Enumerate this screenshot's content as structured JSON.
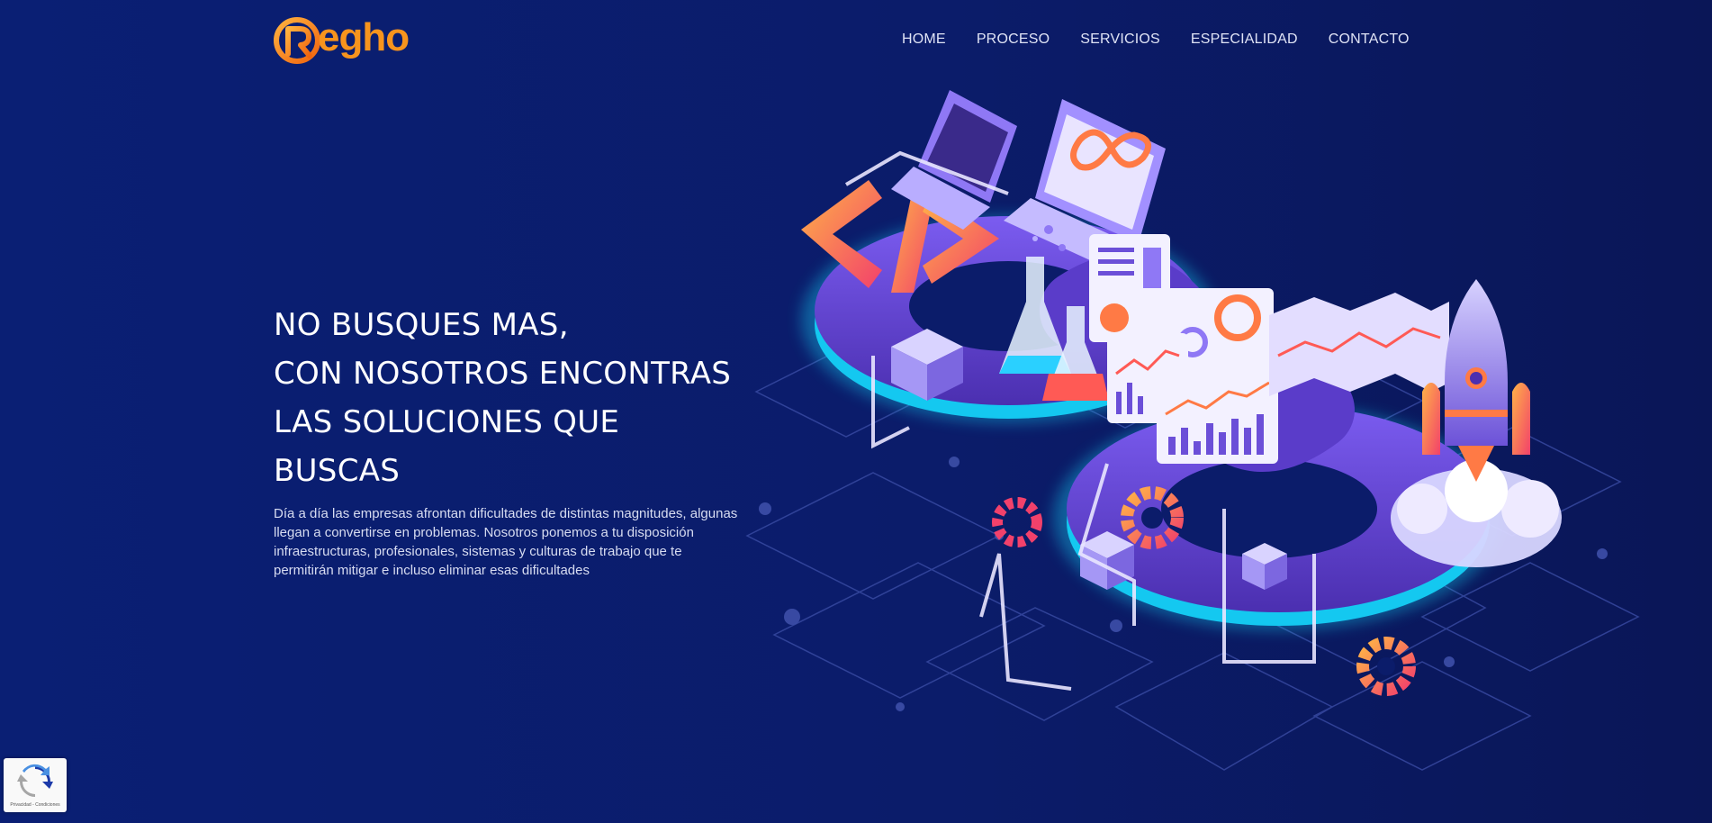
{
  "brand": {
    "logo_text": "egho",
    "logo_icon": "r-circle-logo-icon"
  },
  "nav": {
    "items": [
      {
        "label": "HOME"
      },
      {
        "label": "PROCESO"
      },
      {
        "label": "SERVICIOS"
      },
      {
        "label": "ESPECIALIDAD"
      },
      {
        "label": "CONTACTO"
      }
    ]
  },
  "hero": {
    "title_lines": [
      "NO BUSQUES MAS,",
      "CON NOSOTROS ENCONTRAS",
      "LAS SOLUCIONES QUE",
      "BUSCAS"
    ],
    "description": "Día a día las empresas afrontan dificultades de distintas magnitudes, algunas llegan a convertirse en problemas. Nosotros ponemos a tu disposición infraestructuras, profesionales, sistemas y culturas de trabajo que te permitirán mitigar e incluso eliminar esas dificultades"
  },
  "recaptcha": {
    "label": "Privacidad - Condiciones",
    "icon": "recaptcha-icon"
  },
  "colors": {
    "background": "#0b1c6a",
    "brand_orange": "#f7941d",
    "nav_text": "#dfe3f5",
    "accent_cyan": "#19d3f0",
    "accent_purple": "#6a4fd6"
  }
}
